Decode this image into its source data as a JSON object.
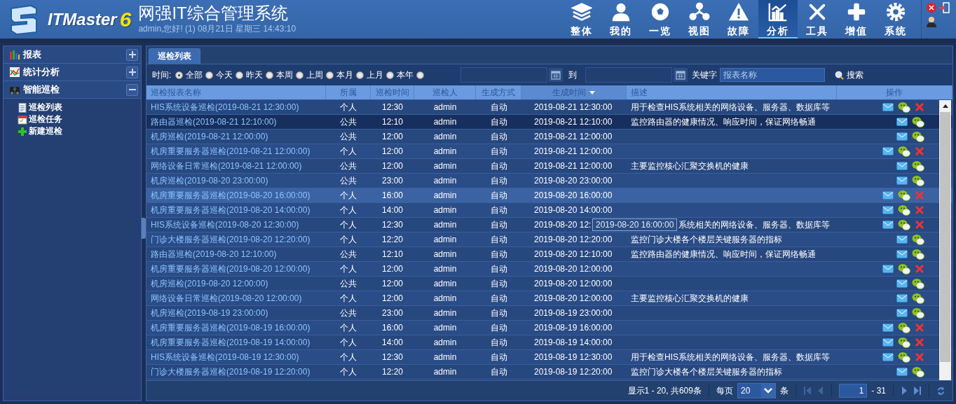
{
  "header": {
    "logo_text": "ITMaster",
    "logo_version": "6",
    "title": "网强IT综合管理系统",
    "subtitle": "admin,您好! (1) 08月21日 星期三 14:43:10"
  },
  "nav": [
    {
      "label": "整体",
      "selected": false
    },
    {
      "label": "我的",
      "selected": false
    },
    {
      "label": "一览",
      "selected": false
    },
    {
      "label": "视图",
      "selected": false
    },
    {
      "label": "故障",
      "selected": false
    },
    {
      "label": "分析",
      "selected": true
    },
    {
      "label": "工具",
      "selected": false
    },
    {
      "label": "增值",
      "selected": false
    },
    {
      "label": "系统",
      "selected": false
    }
  ],
  "sidebar": [
    {
      "label": "报表",
      "expanded": false
    },
    {
      "label": "统计分析",
      "expanded": false
    },
    {
      "label": "智能巡检",
      "expanded": true,
      "children": [
        {
          "label": "巡检列表"
        },
        {
          "label": "巡检任务"
        },
        {
          "label": "新建巡检"
        }
      ]
    }
  ],
  "tabs": [
    {
      "label": "巡检列表",
      "selected": true
    }
  ],
  "filter": {
    "label": "时间:",
    "options": [
      {
        "label": "全部",
        "selected": true
      },
      {
        "label": "今天",
        "selected": false
      },
      {
        "label": "昨天",
        "selected": false
      },
      {
        "label": "本周",
        "selected": false
      },
      {
        "label": "上周",
        "selected": false
      },
      {
        "label": "本月",
        "selected": false
      },
      {
        "label": "上月",
        "selected": false
      },
      {
        "label": "本年",
        "selected": false
      },
      {
        "selected": false
      }
    ],
    "to_label": "到",
    "keyword_label": "关键字",
    "keyword_placeholder": "报表名称",
    "search_button": "搜索"
  },
  "table": {
    "columns": [
      "巡检报表名称",
      "所属",
      "巡检时间",
      "巡检人",
      "生成方式",
      "生成时间",
      "描述",
      "操作"
    ],
    "rows": [
      {
        "name": "HIS系统设备巡检(2019-08-21 12:30:00)",
        "scope": "个人",
        "time": "12:30",
        "user": "admin",
        "mode": "自动",
        "created": "2019-08-21 12:30:00",
        "desc": "用于检查HIS系统相关的网络设备、服务器、数据库等",
        "deletable": true,
        "selected": false,
        "hovered": false
      },
      {
        "name": "路由器巡检(2019-08-21 12:10:00)",
        "scope": "公共",
        "time": "12:10",
        "user": "admin",
        "mode": "自动",
        "created": "2019-08-21 12:10:00",
        "desc": "监控路由器的健康情况、响应时间，保证网络畅通",
        "deletable": false,
        "selected": true,
        "hovered": false
      },
      {
        "name": "机房巡检(2019-08-21 12:00:00)",
        "scope": "公共",
        "time": "12:00",
        "user": "admin",
        "mode": "自动",
        "created": "2019-08-21 12:00:00",
        "deletable": false,
        "selected": false,
        "hovered": false
      },
      {
        "name": "机房重要服务器巡检(2019-08-21 12:00:00)",
        "scope": "个人",
        "time": "12:00",
        "user": "admin",
        "mode": "自动",
        "created": "2019-08-21 12:00:00",
        "deletable": true,
        "selected": false,
        "hovered": false
      },
      {
        "name": "网络设备日常巡检(2019-08-21 12:00:00)",
        "scope": "公共",
        "time": "12:00",
        "user": "admin",
        "mode": "自动",
        "created": "2019-08-21 12:00:00",
        "desc": "主要监控核心汇聚交换机的健康",
        "deletable": false,
        "selected": false,
        "hovered": false
      },
      {
        "name": "机房巡检(2019-08-20 23:00:00)",
        "scope": "公共",
        "time": "23:00",
        "user": "admin",
        "mode": "自动",
        "created": "2019-08-20 23:00:00",
        "deletable": false,
        "selected": false,
        "hovered": false
      },
      {
        "name": "机房重要服务器巡检(2019-08-20 16:00:00)",
        "scope": "个人",
        "time": "16:00",
        "user": "admin",
        "mode": "自动",
        "created": "2019-08-20 16:00:00",
        "deletable": true,
        "selected": false,
        "hovered": true
      },
      {
        "name": "机房重要服务器巡检(2019-08-20 14:00:00)",
        "scope": "个人",
        "time": "14:00",
        "user": "admin",
        "mode": "自动",
        "created": "2019-08-20 14:00:00",
        "deletable": true,
        "selected": false,
        "hovered": false
      },
      {
        "name": "HIS系统设备巡检(2019-08-20 12:30:00)",
        "scope": "个人",
        "time": "12:30",
        "user": "admin",
        "mode": "自动",
        "created": "2019-08-20 12:",
        "tooltip": "2019-08-20 16:00:00",
        "desc": "系统相关的网络设备、服务器、数据库等",
        "deletable": true,
        "selected": false,
        "hovered": false
      },
      {
        "name": "门诊大楼服务器巡检(2019-08-20 12:20:00)",
        "scope": "个人",
        "time": "12:20",
        "user": "admin",
        "mode": "自动",
        "created": "2019-08-20 12:20:00",
        "desc": "监控门诊大楼各个楼层关键服务器的指标",
        "deletable": false,
        "selected": false,
        "hovered": false
      },
      {
        "name": "路由器巡检(2019-08-20 12:10:00)",
        "scope": "公共",
        "time": "12:10",
        "user": "admin",
        "mode": "自动",
        "created": "2019-08-20 12:10:00",
        "desc": "监控路由器的健康情况、响应时间，保证网络畅通",
        "deletable": false,
        "selected": false,
        "hovered": false
      },
      {
        "name": "机房重要服务器巡检(2019-08-20 12:00:00)",
        "scope": "个人",
        "time": "12:00",
        "user": "admin",
        "mode": "自动",
        "created": "2019-08-20 12:00:00",
        "deletable": true,
        "selected": false,
        "hovered": false
      },
      {
        "name": "机房巡检(2019-08-20 12:00:00)",
        "scope": "公共",
        "time": "12:00",
        "user": "admin",
        "mode": "自动",
        "created": "2019-08-20 12:00:00",
        "deletable": false,
        "selected": false,
        "hovered": false
      },
      {
        "name": "网络设备日常巡检(2019-08-20 12:00:00)",
        "scope": "个人",
        "time": "12:00",
        "user": "admin",
        "mode": "自动",
        "created": "2019-08-20 12:00:00",
        "desc": "主要监控核心汇聚交换机的健康",
        "deletable": false,
        "selected": false,
        "hovered": false
      },
      {
        "name": "机房巡检(2019-08-19 23:00:00)",
        "scope": "公共",
        "time": "23:00",
        "user": "admin",
        "mode": "自动",
        "created": "2019-08-19 23:00:00",
        "deletable": false,
        "selected": false,
        "hovered": false
      },
      {
        "name": "机房重要服务器巡检(2019-08-19 16:00:00)",
        "scope": "个人",
        "time": "16:00",
        "user": "admin",
        "mode": "自动",
        "created": "2019-08-19 16:00:00",
        "deletable": true,
        "selected": false,
        "hovered": false
      },
      {
        "name": "机房重要服务器巡检(2019-08-19 14:00:00)",
        "scope": "个人",
        "time": "14:00",
        "user": "admin",
        "mode": "自动",
        "created": "2019-08-19 14:00:00",
        "deletable": true,
        "selected": false,
        "hovered": false
      },
      {
        "name": "HIS系统设备巡检(2019-08-19 12:30:00)",
        "scope": "个人",
        "time": "12:30",
        "user": "admin",
        "mode": "自动",
        "created": "2019-08-19 12:30:00",
        "desc": "用于检查HIS系统相关的网络设备、服务器、数据库等",
        "deletable": true,
        "selected": false,
        "hovered": false
      },
      {
        "name": "门诊大楼服务器巡检(2019-08-19 12:20:00)",
        "scope": "个人",
        "time": "12:20",
        "user": "admin",
        "mode": "自动",
        "created": "2019-08-19 12:20:00",
        "desc": "监控门诊大楼各个楼层关键服务器的指标",
        "deletable": false,
        "selected": false,
        "hovered": false
      }
    ]
  },
  "pager": {
    "summary": "显示1 - 20, 共609条",
    "per_page_label": "每页",
    "per_page": "20",
    "unit": "条",
    "page": "1",
    "total_pages": "- 31"
  }
}
